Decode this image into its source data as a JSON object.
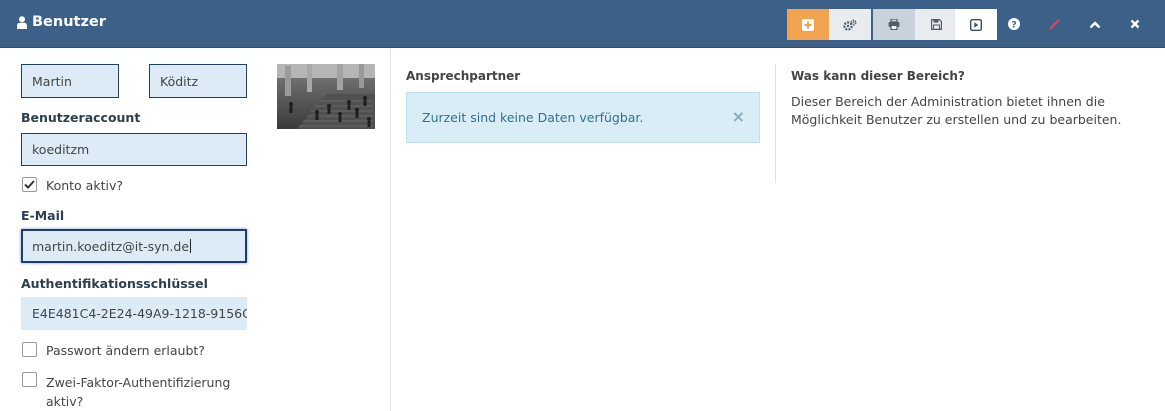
{
  "header": {
    "title": "Benutzer",
    "title_icon": "user-icon",
    "toolbar": [
      {
        "name": "add-button",
        "icon": "plus-square-icon"
      },
      {
        "name": "settings-button",
        "icon": "cogs-icon"
      },
      {
        "name": "print-button",
        "icon": "print-icon"
      },
      {
        "name": "save-button",
        "icon": "floppy-icon"
      },
      {
        "name": "next-button",
        "icon": "play-square-icon"
      }
    ],
    "actions": [
      "help-icon",
      "pencil-icon",
      "chevron-up-icon",
      "close-icon"
    ],
    "colors": {
      "bar": "#3c6087",
      "add": "#f3a24d",
      "pencil": "#e8464f"
    }
  },
  "form": {
    "first_name": "Martin",
    "last_name": "Köditz",
    "account_label": "Benutzeraccount",
    "account_value": "koeditzm",
    "active_label": "Konto aktiv?",
    "active_checked": true,
    "email_label": "E-Mail",
    "email_value": "martin.koeditz@it-syn.de",
    "auth_key_label": "Authentifikationsschlüssel",
    "auth_key_value": "E4E481C4-2E24-49A9-1218-9156C",
    "pw_change_label": "Passwort ändern erlaubt?",
    "pw_change_checked": false,
    "two_factor_label": "Zwei-Faktor-Authentifizierung aktiv?",
    "two_factor_checked": false
  },
  "contacts": {
    "heading": "Ansprechpartner",
    "empty_message": "Zurzeit sind keine Daten verfügbar."
  },
  "info": {
    "heading": "Was kann dieser Bereich?",
    "text": "Dieser Bereich der Administration bietet ihnen die Möglichkeit Benutzer zu erstellen und zu bearbeiten."
  }
}
